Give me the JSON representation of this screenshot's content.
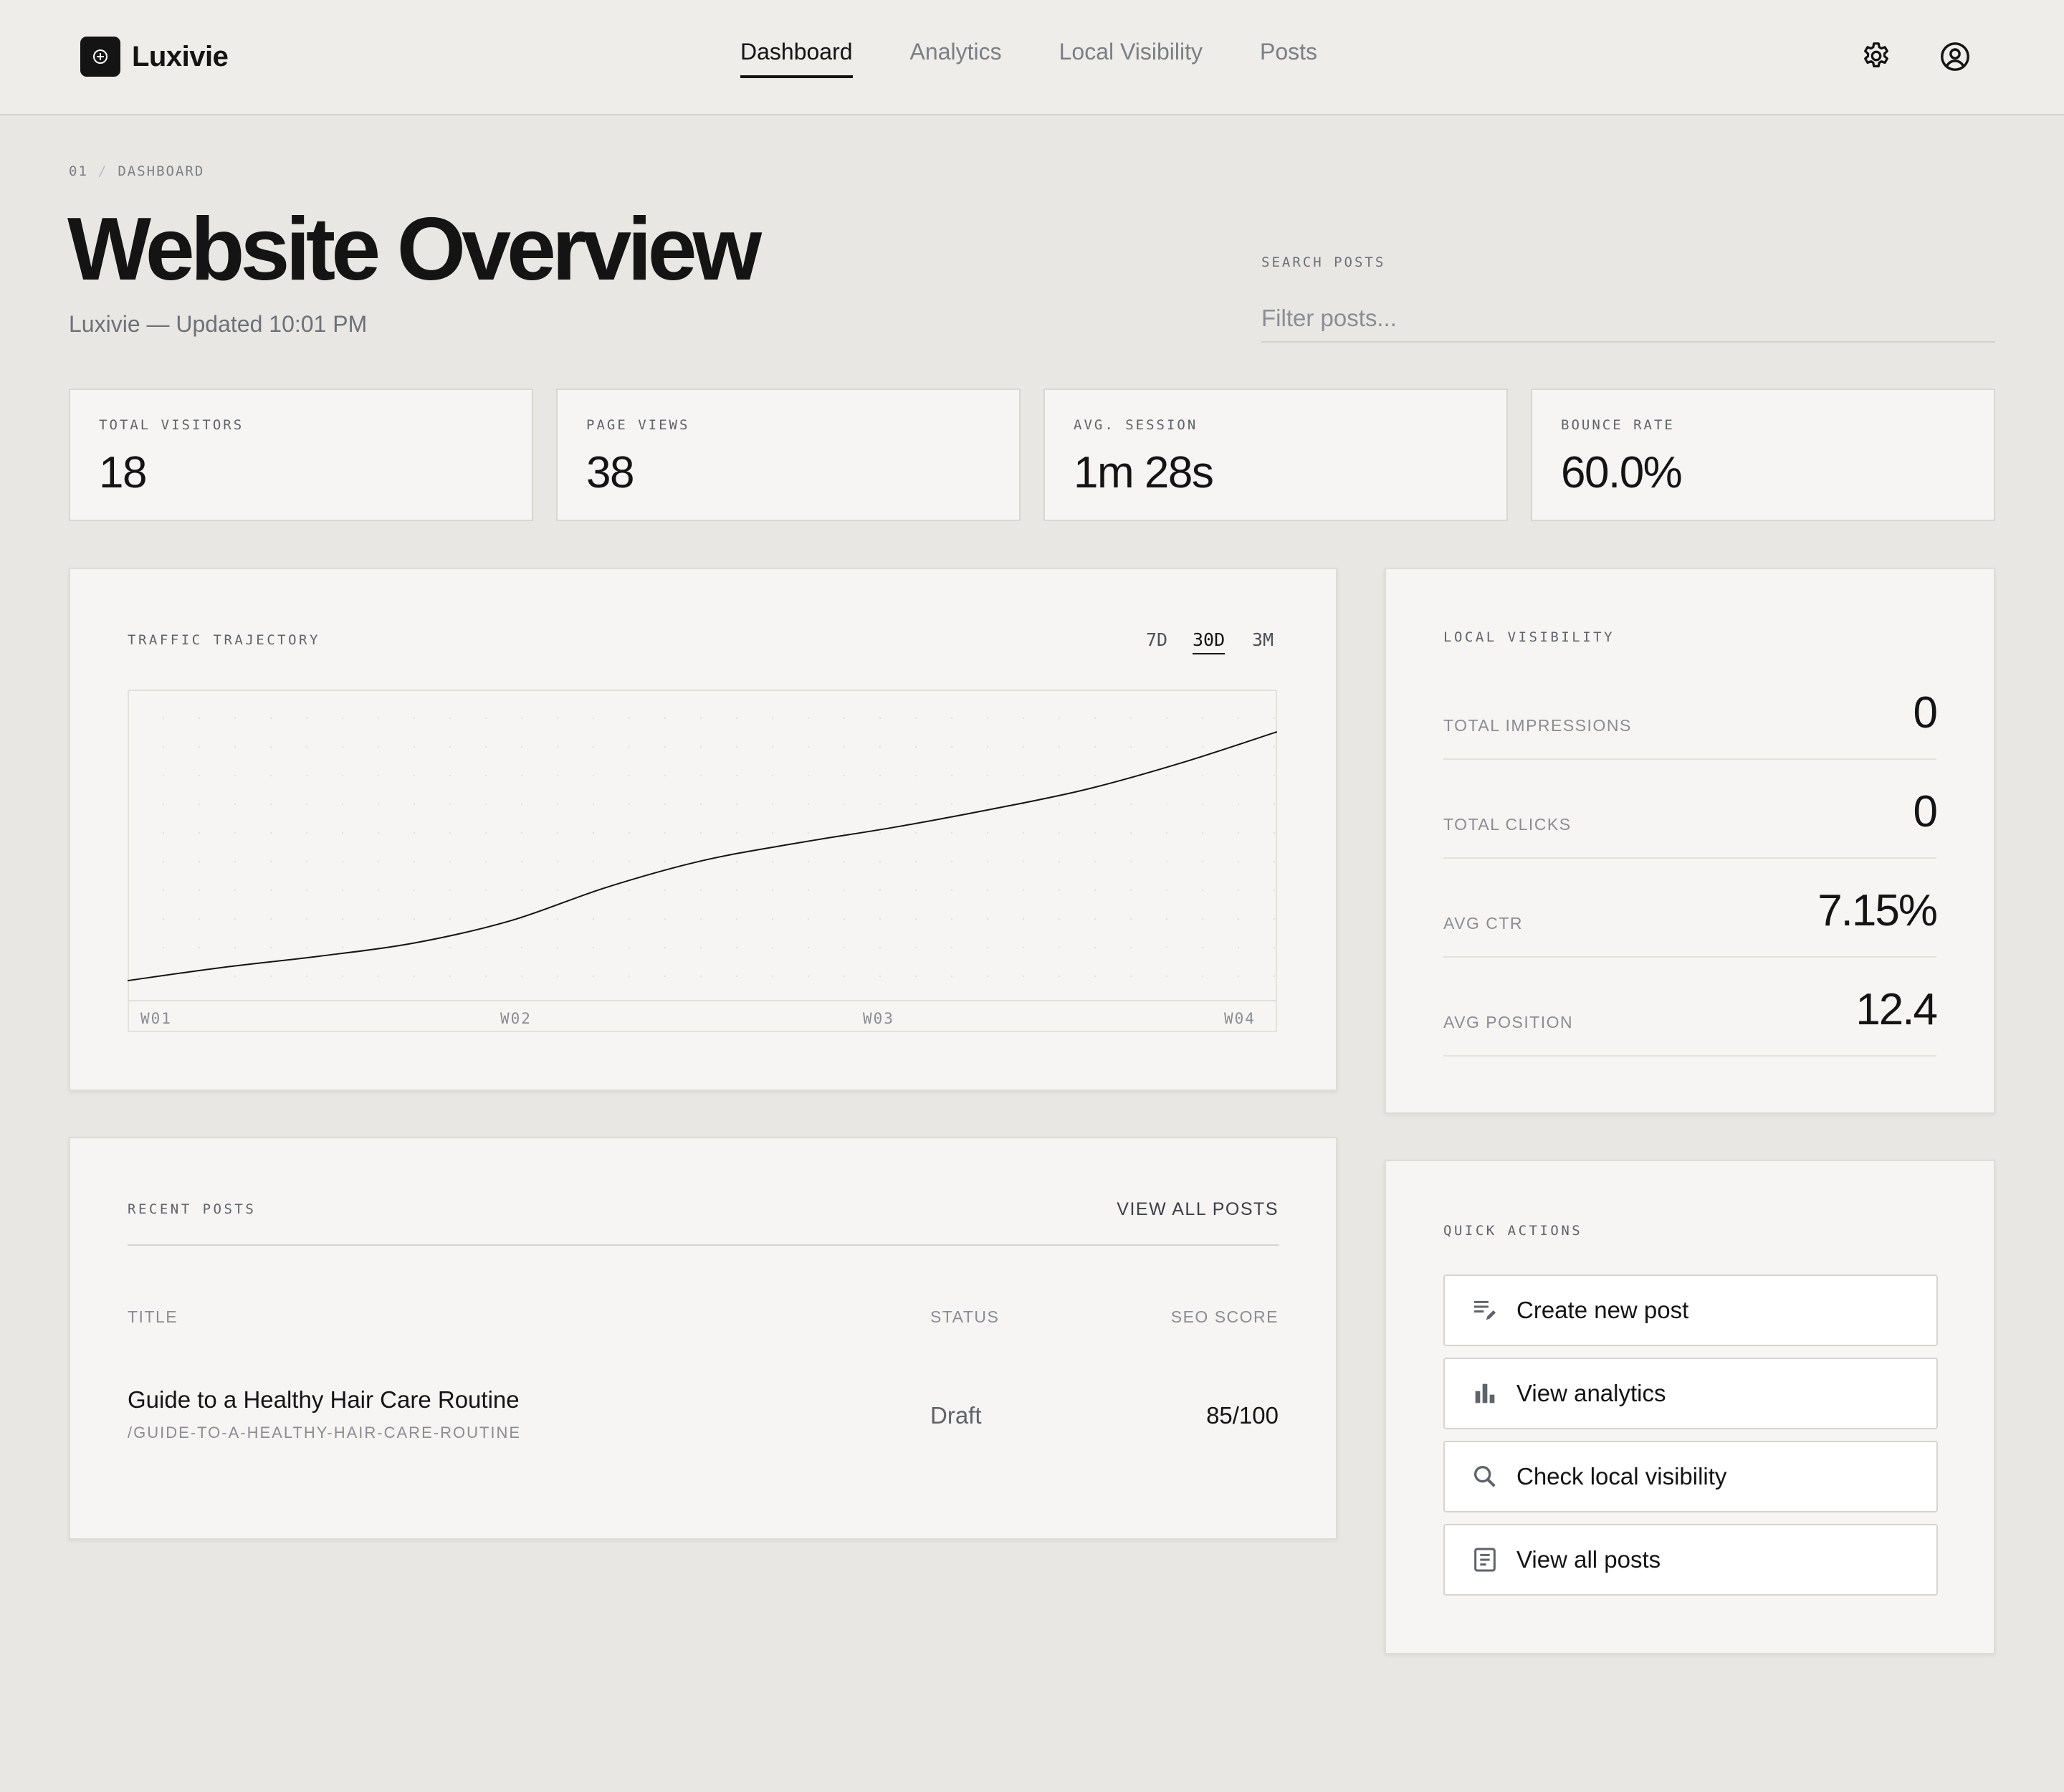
{
  "brand": {
    "name": "Luxivie"
  },
  "nav": {
    "items": [
      {
        "label": "Dashboard",
        "active": true
      },
      {
        "label": "Analytics",
        "active": false
      },
      {
        "label": "Local Visibility",
        "active": false
      },
      {
        "label": "Posts",
        "active": false
      }
    ]
  },
  "header_icons": [
    "gear-icon",
    "user-circle-icon"
  ],
  "breadcrumb": {
    "index": "01",
    "separator": "/",
    "section": "DASHBOARD"
  },
  "page": {
    "title": "Website Overview",
    "subtitle": "Luxivie — Updated 10:01 PM"
  },
  "search": {
    "label": "SEARCH POSTS",
    "placeholder": "Filter posts...",
    "value": ""
  },
  "metrics": [
    {
      "label": "TOTAL VISITORS",
      "value": "18"
    },
    {
      "label": "PAGE VIEWS",
      "value": "38"
    },
    {
      "label": "AVG. SESSION",
      "value": "1m 28s"
    },
    {
      "label": "BOUNCE RATE",
      "value": "60.0%"
    }
  ],
  "traffic": {
    "title": "TRAFFIC TRAJECTORY",
    "ranges": [
      {
        "label": "7D",
        "active": false
      },
      {
        "label": "30D",
        "active": true
      },
      {
        "label": "3M",
        "active": false
      }
    ]
  },
  "chart_data": {
    "type": "line",
    "categories": [
      "W01",
      "W02",
      "W03",
      "W04"
    ],
    "x": [
      0,
      0.25,
      0.5,
      0.75,
      1,
      1.25,
      1.5,
      1.75,
      2,
      2.25,
      2.5,
      2.75,
      3
    ],
    "series": [
      {
        "values": [
          0.09,
          0.15,
          0.2,
          0.26,
          0.36,
          0.51,
          0.63,
          0.71,
          0.78,
          0.86,
          0.95,
          1.07,
          1.21
        ]
      }
    ],
    "ylim": [
      0,
      1.4
    ],
    "grid": "dotted",
    "title": "",
    "xlabel": "",
    "ylabel": ""
  },
  "local_visibility": {
    "title": "LOCAL VISIBILITY",
    "rows": [
      {
        "label": "TOTAL IMPRESSIONS",
        "value": "0"
      },
      {
        "label": "TOTAL CLICKS",
        "value": "0"
      },
      {
        "label": "AVG CTR",
        "value": "7.15%"
      },
      {
        "label": "AVG POSITION",
        "value": "12.4"
      }
    ]
  },
  "recent_posts": {
    "title": "RECENT POSTS",
    "view_all": "VIEW ALL POSTS",
    "columns": [
      "TITLE",
      "STATUS",
      "SEO SCORE"
    ],
    "rows": [
      {
        "title": "Guide to a Healthy Hair Care Routine",
        "slug": "/GUIDE-TO-A-HEALTHY-HAIR-CARE-ROUTINE",
        "status": "Draft",
        "seo_score": "85/100"
      }
    ]
  },
  "quick_actions": {
    "title": "QUICK ACTIONS",
    "items": [
      {
        "label": "Create new post",
        "icon": "edit-list-icon"
      },
      {
        "label": "View analytics",
        "icon": "bar-chart-icon"
      },
      {
        "label": "Check local visibility",
        "icon": "search-icon"
      },
      {
        "label": "View all posts",
        "icon": "document-icon"
      }
    ]
  },
  "colors": {
    "background": "#e8e7e3",
    "card": "#f6f5f3",
    "ink": "#141414",
    "muted": "#7b7f85"
  }
}
